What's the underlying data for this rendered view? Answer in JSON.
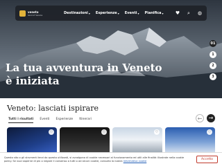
{
  "header": {
    "logo_line1": "veneto",
    "logo_line2": "land of Venice",
    "menu": [
      {
        "label": "Destinazioni"
      },
      {
        "label": "Esperienze"
      },
      {
        "label": "Eventi"
      },
      {
        "label": "Pianifica"
      }
    ],
    "icons": [
      "heart-icon",
      "search-icon",
      "globe-icon"
    ]
  },
  "hero": {
    "title": "La tua avventura in Veneto è iniziata",
    "pager": [
      "01",
      "1",
      "2",
      "3"
    ]
  },
  "section": {
    "title": "Veneto: lasciati ispirare",
    "tabs": [
      "Tutti i risultati",
      "Eventi",
      "Esperienze",
      "Itinerari"
    ]
  },
  "cookie": {
    "text": "Questo sito o gli strumenti terzi da questo utilizzati, si avvalgono di cookie necessari al funzionamento ed utili alle finalità illustrate nella cookie policy. Se vuoi saperne di più o negare il consenso a tutti o ad alcuni cookie, consulta la nostra",
    "link": "Informativa cookie",
    "accept": "Accetto"
  },
  "colors": {
    "nav_bg": "#1e2228",
    "accent_red": "#c0392b",
    "logo_yellow": "#e2b33a"
  }
}
